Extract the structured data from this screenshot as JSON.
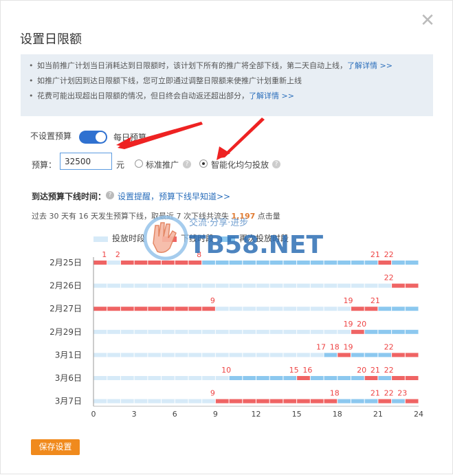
{
  "dialog": {
    "title": "设置日限额",
    "close_icon": "close-icon"
  },
  "notice": {
    "items": [
      {
        "text": "如当前推广计划当日消耗达到日限额时，该计划下所有的推广将全部下线，第二天自动上线，",
        "link": "了解详情 >>"
      },
      {
        "text": "如推广计划因到达日限额下线，您可立即通过调整日限额来使推广计划重新上线",
        "link": ""
      },
      {
        "text": "花费可能出现超出日限额的情况，但日终会自动返还超出部分，",
        "link": "了解详情 >>"
      }
    ]
  },
  "budget": {
    "no_budget_label": "不设置预算",
    "daily_budget_label": "每日预算",
    "toggle_on": true,
    "amount_label": "预算：",
    "amount_value": "32500",
    "unit": "元",
    "options": [
      {
        "label": "标准推广",
        "selected": false
      },
      {
        "label": "智能化均匀投放",
        "selected": true
      }
    ]
  },
  "offline_section": {
    "title": "到达预算下线时间：",
    "link": "设置提醒，预算下线早知道>>",
    "stats_prefix": "过去 30 天有 16 天发生预算下线，取最近 7 次下线共流失 ",
    "stats_value": "1,197",
    "stats_suffix": " 点击量"
  },
  "legend": {
    "on_label": "投放时段",
    "off_label": "下线时段",
    "resume_label": "再次投放时段",
    "colors": {
      "on": "#d6eaf8",
      "off": "#ef6464",
      "resume": "#8cc8ef"
    }
  },
  "chart_data": {
    "type": "timeline",
    "x_ticks": [
      "0",
      "3",
      "6",
      "9",
      "12",
      "15",
      "18",
      "21",
      "24"
    ],
    "xlim": [
      0,
      24
    ],
    "rows": [
      {
        "date": "2月25日",
        "segments": [
          [
            0,
            1,
            "off"
          ],
          [
            1,
            2,
            "on"
          ],
          [
            2,
            8,
            "off"
          ],
          [
            8,
            21,
            "resume"
          ],
          [
            21,
            22,
            "off"
          ],
          [
            22,
            24,
            "resume"
          ]
        ],
        "labels": [
          1,
          2,
          8,
          21,
          22
        ]
      },
      {
        "date": "2月26日",
        "segments": [
          [
            0,
            22,
            "on"
          ],
          [
            22,
            24,
            "off"
          ]
        ],
        "labels": [
          22
        ]
      },
      {
        "date": "2月27日",
        "segments": [
          [
            0,
            9,
            "off"
          ],
          [
            9,
            19,
            "on"
          ],
          [
            19,
            21,
            "off"
          ],
          [
            21,
            24,
            "resume"
          ]
        ],
        "labels": [
          9,
          19,
          21
        ]
      },
      {
        "date": "2月29日",
        "segments": [
          [
            0,
            19,
            "on"
          ],
          [
            19,
            20,
            "off"
          ],
          [
            20,
            24,
            "resume"
          ]
        ],
        "labels": [
          19,
          20
        ]
      },
      {
        "date": "3月1日",
        "segments": [
          [
            0,
            17,
            "on"
          ],
          [
            17,
            18,
            "resume"
          ],
          [
            18,
            19,
            "off"
          ],
          [
            19,
            22,
            "resume"
          ],
          [
            22,
            24,
            "off"
          ]
        ],
        "labels": [
          17,
          18,
          19,
          22
        ]
      },
      {
        "date": "3月6日",
        "segments": [
          [
            0,
            10,
            "on"
          ],
          [
            10,
            15,
            "resume"
          ],
          [
            15,
            16,
            "off"
          ],
          [
            16,
            20,
            "resume"
          ],
          [
            20,
            21,
            "off"
          ],
          [
            21,
            22,
            "resume"
          ],
          [
            22,
            24,
            "off"
          ]
        ],
        "labels": [
          10,
          15,
          16,
          20,
          21,
          22
        ]
      },
      {
        "date": "3月7日",
        "segments": [
          [
            0,
            9,
            "on"
          ],
          [
            9,
            18,
            "off"
          ],
          [
            18,
            21,
            "resume"
          ],
          [
            21,
            22,
            "off"
          ],
          [
            22,
            23,
            "resume"
          ],
          [
            23,
            24,
            "off"
          ]
        ],
        "labels": [
          9,
          18,
          21,
          22,
          23
        ]
      }
    ]
  },
  "footer": {
    "save_label": "保存设置"
  },
  "watermark": {
    "text": "TB58.NET",
    "slogan": "交流·分享·进步"
  }
}
